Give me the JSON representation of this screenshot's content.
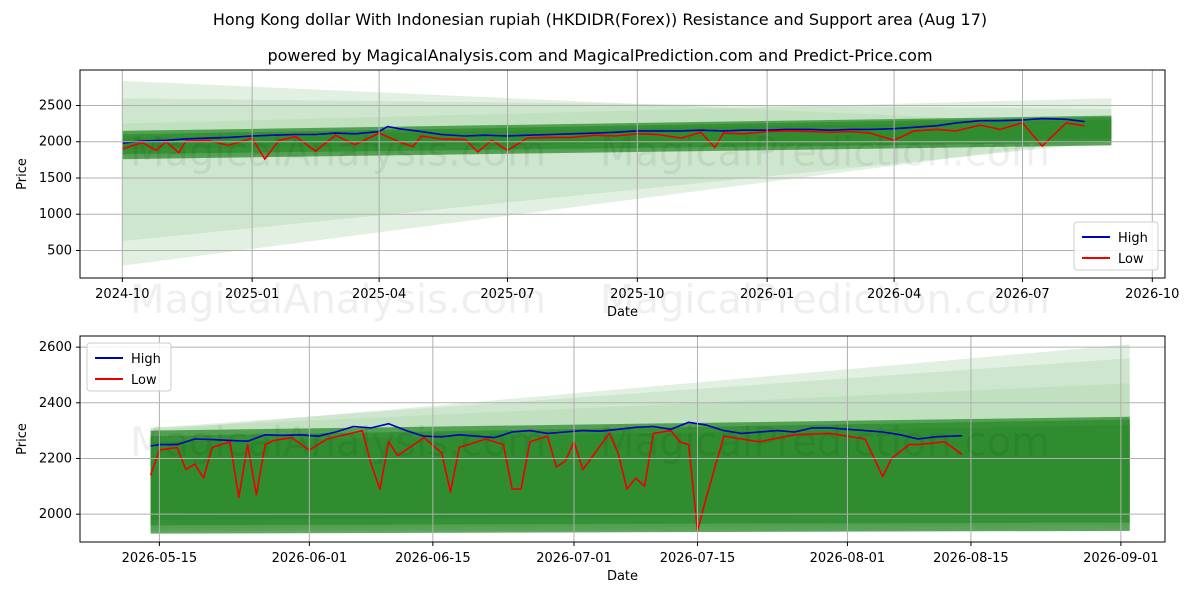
{
  "title": "Hong Kong dollar With Indonesian rupiah (HKDIDR(Forex)) Resistance and Support area (Aug 17)",
  "subtitle": "powered by MagicalAnalysis.com and MagicalPrediction.com and Predict-Price.com",
  "watermarks": [
    "MagicalAnalysis.com",
    "MagicalPrediction.com"
  ],
  "colors": {
    "high": "#0000bb",
    "low": "#ee0000",
    "band_dark": "#2e8b2e",
    "band_light": "#a8d5a8"
  },
  "chart_data": [
    {
      "type": "line",
      "xlabel": "Date",
      "ylabel": "Price",
      "xlim": [
        "2024-09-01",
        "2026-10-10"
      ],
      "ylim": [
        120,
        2990
      ],
      "x_ticks": [
        "2024-10",
        "2025-01",
        "2025-04",
        "2025-07",
        "2025-10",
        "2026-01",
        "2026-04",
        "2026-07",
        "2026-10"
      ],
      "y_ticks": [
        500,
        1000,
        1500,
        2000,
        2500
      ],
      "legend": {
        "placement": "lower-right",
        "entries": [
          "High",
          "Low"
        ]
      },
      "zones": {
        "x_start": "2024-10-01",
        "x_end": "2026-09-02",
        "light_fans": [
          {
            "upper": [
              2840,
              2230
            ],
            "lower": [
              290,
              2060
            ]
          },
          {
            "upper": [
              2600,
              2450
            ],
            "lower": [
              630,
              2000
            ]
          },
          {
            "upper": [
              2250,
              2600
            ],
            "lower": [
              1800,
              1960
            ]
          }
        ],
        "dark_bands": [
          {
            "upper": [
              2150,
              2360
            ],
            "lower": [
              1760,
              1950
            ]
          },
          {
            "upper": [
              2100,
              2340
            ],
            "lower": [
              1830,
              1990
            ]
          },
          {
            "upper": [
              2050,
              2300
            ],
            "lower": [
              1900,
              2050
            ]
          }
        ]
      },
      "series": [
        {
          "name": "High",
          "x": [
            "2024-10-01",
            "2024-10-15",
            "2024-11-01",
            "2024-11-15",
            "2024-12-01",
            "2024-12-15",
            "2025-01-01",
            "2025-01-15",
            "2025-02-01",
            "2025-02-15",
            "2025-03-01",
            "2025-03-15",
            "2025-04-01",
            "2025-04-07",
            "2025-04-15",
            "2025-05-01",
            "2025-05-15",
            "2025-06-01",
            "2025-06-15",
            "2025-07-01",
            "2025-07-15",
            "2025-08-01",
            "2025-08-15",
            "2025-09-01",
            "2025-09-15",
            "2025-10-01",
            "2025-10-15",
            "2025-11-01",
            "2025-11-15",
            "2025-12-01",
            "2025-12-15",
            "2026-01-01",
            "2026-01-15",
            "2026-02-01",
            "2026-02-15",
            "2026-03-01",
            "2026-03-15",
            "2026-04-01",
            "2026-04-15",
            "2026-05-01",
            "2026-05-15",
            "2026-06-01",
            "2026-06-15",
            "2026-07-01",
            "2026-07-15",
            "2026-08-01",
            "2026-08-14"
          ],
          "values": [
            1980,
            2010,
            2020,
            2040,
            2050,
            2060,
            2080,
            2090,
            2100,
            2100,
            2120,
            2110,
            2140,
            2210,
            2180,
            2140,
            2100,
            2080,
            2090,
            2080,
            2090,
            2100,
            2110,
            2120,
            2130,
            2150,
            2150,
            2150,
            2160,
            2150,
            2160,
            2160,
            2170,
            2170,
            2160,
            2170,
            2170,
            2180,
            2200,
            2220,
            2260,
            2290,
            2290,
            2300,
            2320,
            2310,
            2280
          ]
        },
        {
          "name": "Low",
          "x": [
            "2024-10-01",
            "2024-10-15",
            "2024-10-25",
            "2024-11-01",
            "2024-11-10",
            "2024-11-15",
            "2024-12-01",
            "2024-12-15",
            "2025-01-01",
            "2025-01-10",
            "2025-01-20",
            "2025-02-01",
            "2025-02-15",
            "2025-03-01",
            "2025-03-15",
            "2025-04-01",
            "2025-04-15",
            "2025-04-25",
            "2025-05-01",
            "2025-05-15",
            "2025-06-01",
            "2025-06-10",
            "2025-06-20",
            "2025-07-01",
            "2025-07-15",
            "2025-08-01",
            "2025-08-15",
            "2025-09-01",
            "2025-09-15",
            "2025-10-01",
            "2025-10-15",
            "2025-11-01",
            "2025-11-15",
            "2025-11-25",
            "2025-12-01",
            "2025-12-15",
            "2026-01-01",
            "2026-01-15",
            "2026-02-01",
            "2026-02-15",
            "2026-03-01",
            "2026-03-15",
            "2026-04-01",
            "2026-04-15",
            "2026-05-01",
            "2026-05-15",
            "2026-06-01",
            "2026-06-15",
            "2026-07-01",
            "2026-07-15",
            "2026-08-01",
            "2026-08-14"
          ],
          "values": [
            1900,
            1990,
            1880,
            2000,
            1850,
            2010,
            2020,
            1950,
            2050,
            1760,
            2020,
            2070,
            1870,
            2090,
            1960,
            2120,
            2000,
            1930,
            2080,
            2040,
            2030,
            1860,
            2020,
            1880,
            2050,
            2060,
            2060,
            2090,
            2080,
            2110,
            2100,
            2050,
            2130,
            1920,
            2120,
            2110,
            2140,
            2150,
            2140,
            2130,
            2140,
            2120,
            2020,
            2150,
            2170,
            2150,
            2230,
            2170,
            2260,
            1940,
            2260,
            2220
          ]
        }
      ]
    },
    {
      "type": "line",
      "xlabel": "Date",
      "ylabel": "Price",
      "xlim": [
        "2026-05-06",
        "2026-09-06"
      ],
      "ylim": [
        1900,
        2640
      ],
      "x_ticks": [
        "2026-05-15",
        "2026-06-01",
        "2026-06-15",
        "2026-07-01",
        "2026-07-15",
        "2026-08-01",
        "2026-08-15",
        "2026-09-01"
      ],
      "y_ticks": [
        2000,
        2200,
        2400,
        2600
      ],
      "legend": {
        "placement": "upper-left",
        "entries": [
          "High",
          "Low"
        ]
      },
      "zones": {
        "x_start": "2026-05-14",
        "x_end": "2026-09-02",
        "light_fans": [
          {
            "upper": [
              2300,
              2610
            ],
            "lower": [
              1940,
              1940
            ]
          },
          {
            "upper": [
              2310,
              2560
            ],
            "lower": [
              1940,
              1950
            ]
          },
          {
            "upper": [
              2310,
              2470
            ],
            "lower": [
              1950,
              1960
            ]
          }
        ],
        "dark_bands": [
          {
            "upper": [
              2300,
              2350
            ],
            "lower": [
              1930,
              1940
            ]
          },
          {
            "upper": [
              2280,
              2340
            ],
            "lower": [
              1960,
              1970
            ]
          },
          {
            "upper": [
              2260,
              2320
            ],
            "lower": [
              1980,
              2000
            ]
          }
        ]
      },
      "series": [
        {
          "name": "High",
          "x": [
            "2026-05-14",
            "2026-05-15",
            "2026-05-17",
            "2026-05-19",
            "2026-05-21",
            "2026-05-23",
            "2026-05-25",
            "2026-05-27",
            "2026-05-29",
            "2026-05-31",
            "2026-06-02",
            "2026-06-04",
            "2026-06-06",
            "2026-06-08",
            "2026-06-10",
            "2026-06-12",
            "2026-06-14",
            "2026-06-16",
            "2026-06-18",
            "2026-06-20",
            "2026-06-22",
            "2026-06-24",
            "2026-06-26",
            "2026-06-28",
            "2026-06-30",
            "2026-07-02",
            "2026-07-04",
            "2026-07-06",
            "2026-07-08",
            "2026-07-10",
            "2026-07-12",
            "2026-07-14",
            "2026-07-16",
            "2026-07-18",
            "2026-07-20",
            "2026-07-22",
            "2026-07-24",
            "2026-07-26",
            "2026-07-28",
            "2026-07-30",
            "2026-08-01",
            "2026-08-03",
            "2026-08-05",
            "2026-08-07",
            "2026-08-09",
            "2026-08-11",
            "2026-08-14"
          ],
          "values": [
            2245,
            2250,
            2250,
            2270,
            2268,
            2265,
            2262,
            2285,
            2283,
            2285,
            2280,
            2295,
            2315,
            2310,
            2325,
            2300,
            2280,
            2278,
            2285,
            2280,
            2275,
            2295,
            2300,
            2290,
            2295,
            2300,
            2298,
            2305,
            2312,
            2315,
            2305,
            2330,
            2320,
            2300,
            2290,
            2295,
            2300,
            2295,
            2310,
            2310,
            2305,
            2300,
            2295,
            2285,
            2270,
            2278,
            2282
          ]
        },
        {
          "name": "Low",
          "x": [
            "2026-05-14",
            "2026-05-15",
            "2026-05-17",
            "2026-05-18",
            "2026-05-19",
            "2026-05-20",
            "2026-05-21",
            "2026-05-23",
            "2026-05-24",
            "2026-05-25",
            "2026-05-26",
            "2026-05-27",
            "2026-05-28",
            "2026-05-30",
            "2026-06-01",
            "2026-06-03",
            "2026-06-07",
            "2026-06-08",
            "2026-06-09",
            "2026-06-10",
            "2026-06-11",
            "2026-06-14",
            "2026-06-16",
            "2026-06-17",
            "2026-06-18",
            "2026-06-21",
            "2026-06-23",
            "2026-06-24",
            "2026-06-25",
            "2026-06-26",
            "2026-06-28",
            "2026-06-29",
            "2026-06-30",
            "2026-07-01",
            "2026-07-02",
            "2026-07-05",
            "2026-07-06",
            "2026-07-07",
            "2026-07-08",
            "2026-07-09",
            "2026-07-10",
            "2026-07-12",
            "2026-07-13",
            "2026-07-14",
            "2026-07-15",
            "2026-07-16",
            "2026-07-18",
            "2026-07-22",
            "2026-07-26",
            "2026-07-30",
            "2026-08-03",
            "2026-08-05",
            "2026-08-06",
            "2026-08-08",
            "2026-08-09",
            "2026-08-12",
            "2026-08-14"
          ],
          "values": [
            2140,
            2230,
            2240,
            2160,
            2180,
            2130,
            2240,
            2260,
            2060,
            2250,
            2070,
            2250,
            2265,
            2275,
            2230,
            2270,
            2300,
            2180,
            2090,
            2260,
            2210,
            2275,
            2220,
            2080,
            2240,
            2270,
            2250,
            2090,
            2090,
            2260,
            2280,
            2170,
            2190,
            2260,
            2160,
            2290,
            2220,
            2090,
            2130,
            2100,
            2290,
            2300,
            2260,
            2250,
            1940,
            2060,
            2280,
            2260,
            2285,
            2290,
            2270,
            2135,
            2200,
            2250,
            2250,
            2260,
            2215
          ]
        }
      ]
    }
  ]
}
